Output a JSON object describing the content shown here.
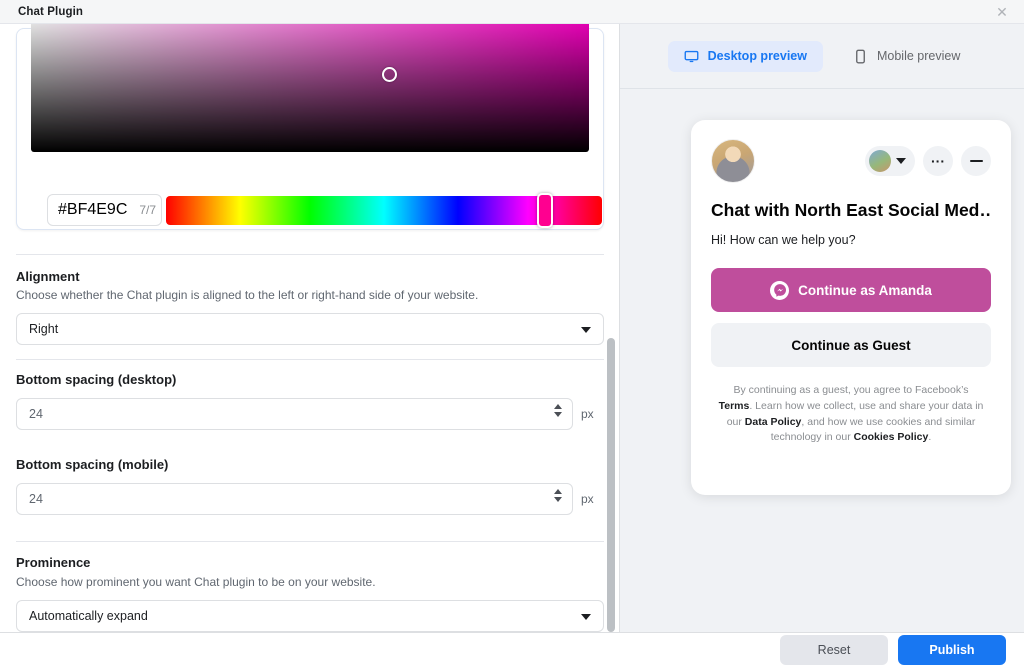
{
  "window": {
    "title": "Chat Plugin",
    "close_icon": "close-icon"
  },
  "color_picker": {
    "hex_value": "#BF4E9C",
    "counter": "7/7",
    "selected_color": "#BF4E9C",
    "saturation_cursor_icon": "color-cursor-icon",
    "hue_thumb_icon": "hue-thumb-icon"
  },
  "settings": {
    "alignment": {
      "label": "Alignment",
      "description": "Choose whether the Chat plugin is aligned to the left or right-hand side of your website.",
      "value": "Right"
    },
    "bottom_spacing_desktop": {
      "label": "Bottom spacing (desktop)",
      "value": "24",
      "unit": "px"
    },
    "bottom_spacing_mobile": {
      "label": "Bottom spacing (mobile)",
      "value": "24",
      "unit": "px"
    },
    "prominence": {
      "label": "Prominence",
      "description": "Choose how prominent you want Chat plugin to be on your website.",
      "value": "Automatically expand"
    }
  },
  "preview": {
    "tabs": [
      {
        "label": "Desktop preview",
        "icon": "desktop-icon",
        "active": true
      },
      {
        "label": "Mobile preview",
        "icon": "mobile-icon",
        "active": false
      }
    ],
    "chat": {
      "title": "Chat with North East Social Med…",
      "greeting": "Hi! How can we help you?",
      "primary_button": "Continue as Amanda",
      "secondary_button": "Continue as Guest",
      "legal": {
        "part1": "By continuing as a guest, you agree to Facebook’s ",
        "link1": "Terms",
        "part2": ". Learn how we collect, use and share your data in our ",
        "link2": "Data Policy",
        "part3": ", and how we use cookies and similar technology in our ",
        "link3": "Cookies Policy",
        "part4": "."
      },
      "avatar_icon": "profile-avatar",
      "account_switch_icon": "account-switcher",
      "more_icon": "more-options-icon",
      "minimize_icon": "minimize-icon",
      "messenger_icon": "messenger-icon"
    },
    "fab_icon": "messenger-bubble-icon"
  },
  "footer": {
    "reset_label": "Reset",
    "publish_label": "Publish",
    "publish_color": "#1877F2"
  }
}
